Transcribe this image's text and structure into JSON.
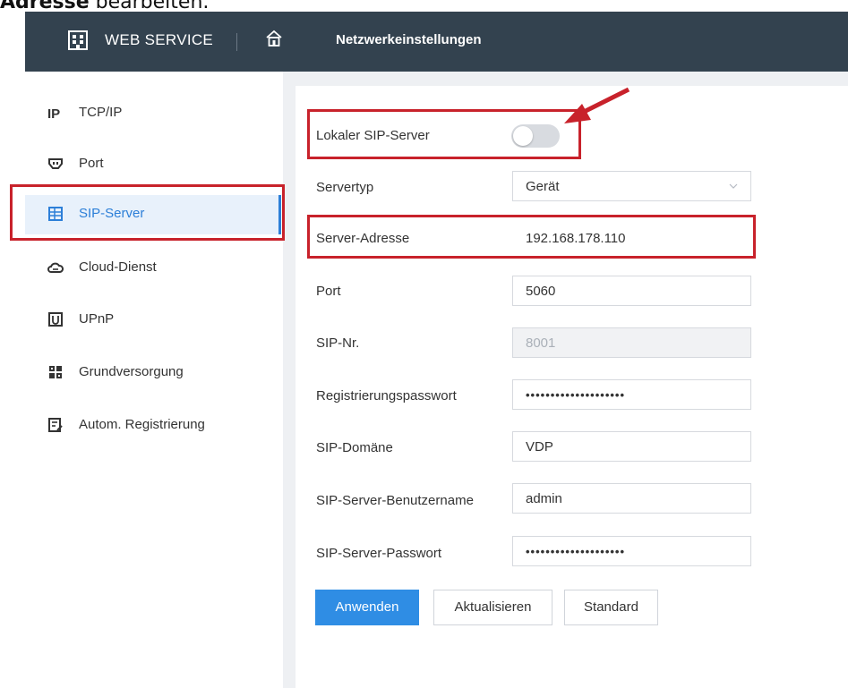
{
  "caption": {
    "bold": "Adresse",
    "rest": " bearbeiten."
  },
  "header": {
    "app_name": "WEB SERVICE",
    "page_title": "Netzwerkeinstellungen"
  },
  "sidebar": {
    "items": [
      {
        "label": "TCP/IP",
        "icon": "ip-icon"
      },
      {
        "label": "Port",
        "icon": "port-icon"
      },
      {
        "label": "SIP-Server",
        "icon": "sip-server-icon",
        "active": true
      },
      {
        "label": "Cloud-Dienst",
        "icon": "cloud-icon"
      },
      {
        "label": "UPnP",
        "icon": "upnp-icon"
      },
      {
        "label": "Grundversorgung",
        "icon": "grid-icon"
      },
      {
        "label": "Autom. Registrierung",
        "icon": "registration-icon"
      }
    ]
  },
  "form": {
    "local_sip": {
      "label": "Lokaler SIP-Server",
      "enabled": false
    },
    "server_type": {
      "label": "Servertyp",
      "value": "Gerät"
    },
    "server_address": {
      "label": "Server-Adresse",
      "value": "192.168.178.110"
    },
    "port": {
      "label": "Port",
      "value": "5060"
    },
    "sip_nr": {
      "label": "SIP-Nr.",
      "value": "8001"
    },
    "reg_password": {
      "label": "Registrierungspasswort",
      "value": "••••••••••••••••••••"
    },
    "sip_domain": {
      "label": "SIP-Domäne",
      "value": "VDP"
    },
    "sip_user": {
      "label": "SIP-Server-Benutzername",
      "value": "admin"
    },
    "sip_password": {
      "label": "SIP-Server-Passwort",
      "value": "••••••••••••••••••••"
    }
  },
  "buttons": {
    "apply": "Anwenden",
    "refresh": "Aktualisieren",
    "default": "Standard"
  },
  "colors": {
    "header_bg": "#33424f",
    "accent": "#2c7fd8",
    "highlight": "#c8222b",
    "primary_button": "#2f8de4"
  }
}
